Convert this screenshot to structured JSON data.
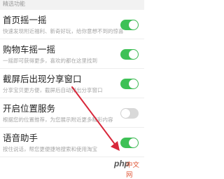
{
  "section": {
    "header": "精选功能"
  },
  "items": [
    {
      "title": "首页摇一摇",
      "desc": "快速发现附近福利、新奇好玩，给你意想不到的惊喜",
      "toggle_on": true
    },
    {
      "title": "购物车摇一摇",
      "desc": "一摇即可获得更多，喜欢的都在这里找到",
      "toggle_on": true
    },
    {
      "title": "截屏后出现分享窗口",
      "desc": "分享宝贝更方便，截屏后自动弹出分享窗口",
      "toggle_on": true
    },
    {
      "title": "开启位置服务",
      "desc": "根据您的位置推荐，为您展示附近更多精彩内容",
      "toggle_on": false
    },
    {
      "title": "语音助手",
      "desc": "按住说话，帮您更便捷地搜索和使用淘宝",
      "toggle_on": true
    }
  ],
  "annotation": {
    "arrow_color": "#d8273a"
  },
  "watermark": {
    "part1": "php",
    "part2": "中文网"
  },
  "colors": {
    "toggle_on": "#3ec156",
    "toggle_off": "#d9d9d9"
  }
}
